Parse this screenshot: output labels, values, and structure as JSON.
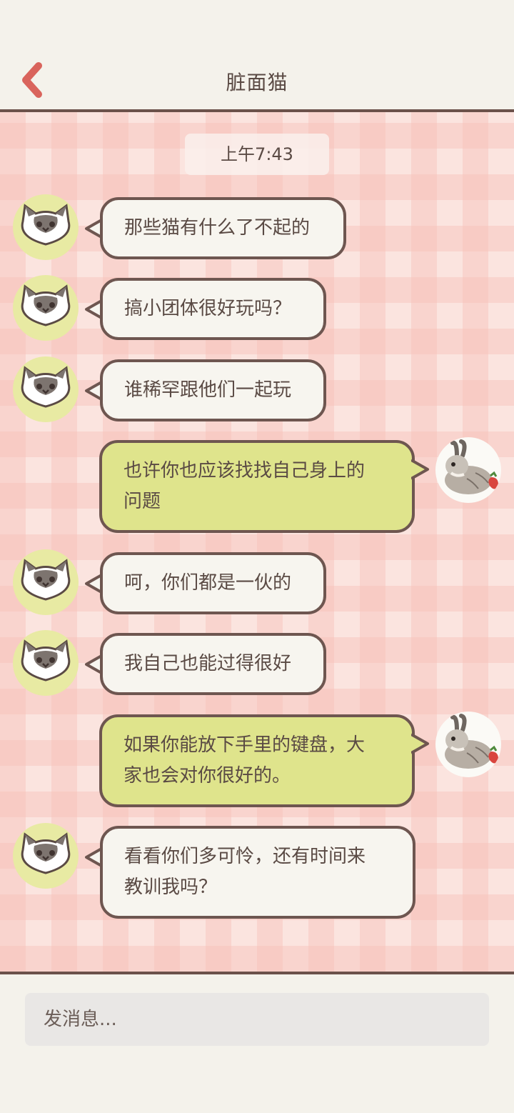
{
  "header": {
    "title": "脏面猫",
    "back_icon": "chevron-left-icon"
  },
  "chat": {
    "timestamp": "上午7:43",
    "messages": [
      {
        "from": "cat",
        "text": "那些猫有什么了不起的"
      },
      {
        "from": "cat",
        "text": "搞小团体很好玩吗？"
      },
      {
        "from": "cat",
        "text": "谁稀罕跟他们一起玩"
      },
      {
        "from": "rabbit",
        "text": "也许你也应该找找自己身上的\n问题"
      },
      {
        "from": "cat",
        "text": "呵，你们都是一伙的"
      },
      {
        "from": "cat",
        "text": "我自己也能过得很好"
      },
      {
        "from": "rabbit",
        "text": "如果你能放下手里的键盘，大\n家也会对你很好的。"
      },
      {
        "from": "cat",
        "text": "看看你们多可怜，还有时间来\n教训我吗？"
      }
    ]
  },
  "composer": {
    "placeholder": "发消息..."
  },
  "colors": {
    "background": "#f4f2eb",
    "accent_back": "#d9645c",
    "border": "#6b514a",
    "incoming_bubble": "#f7f5ef",
    "outgoing_bubble": "#dfe48c",
    "cat_avatar_bg": "#e8eaa3",
    "chat_bg": "#fbe4df"
  }
}
